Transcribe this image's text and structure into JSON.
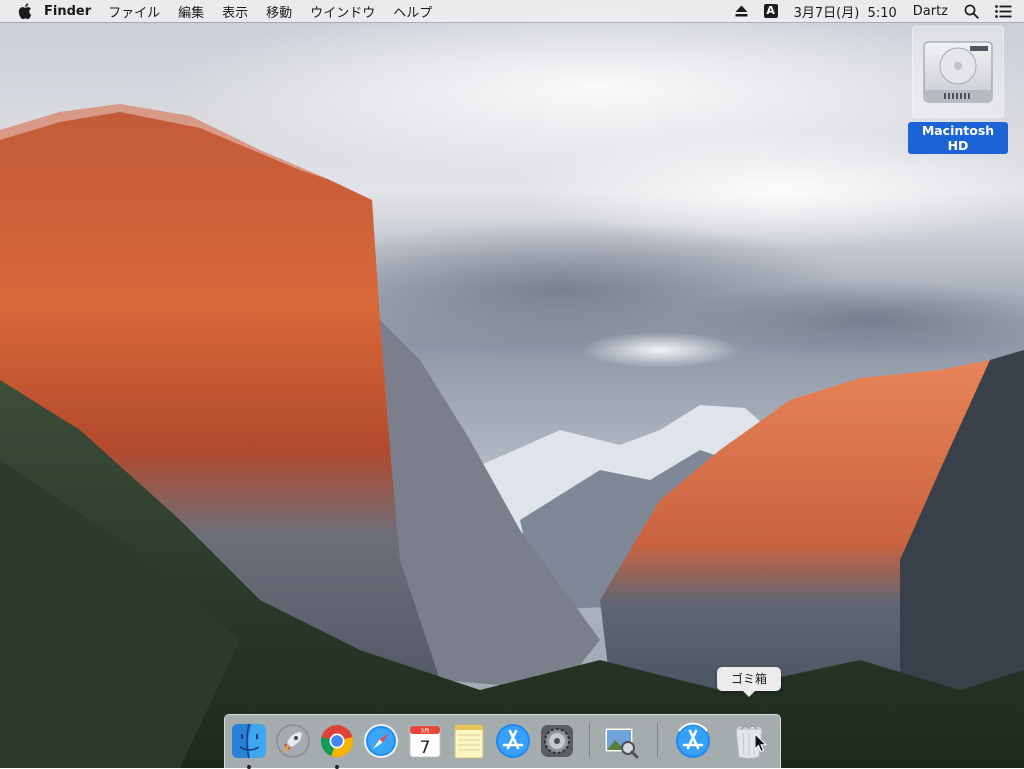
{
  "menubar": {
    "app_name": "Finder",
    "menus": [
      "ファイル",
      "編集",
      "表示",
      "移動",
      "ウインドウ",
      "ヘルプ"
    ],
    "input_source": "A",
    "datetime": "3月7日(月)  5:10",
    "user": "Dartz"
  },
  "desktop": {
    "drive_label": "Macintosh HD"
  },
  "dock": {
    "tooltip": "ゴミ箱",
    "calendar_month": "3月",
    "calendar_day": "7",
    "items": [
      "finder",
      "launchpad",
      "chrome",
      "safari",
      "calendar",
      "notes",
      "app-store",
      "system-preferences",
      "preview",
      "app-store-downloads",
      "trash"
    ]
  },
  "colors": {
    "selection": "#1b63d6",
    "menubar": "#ececee"
  }
}
